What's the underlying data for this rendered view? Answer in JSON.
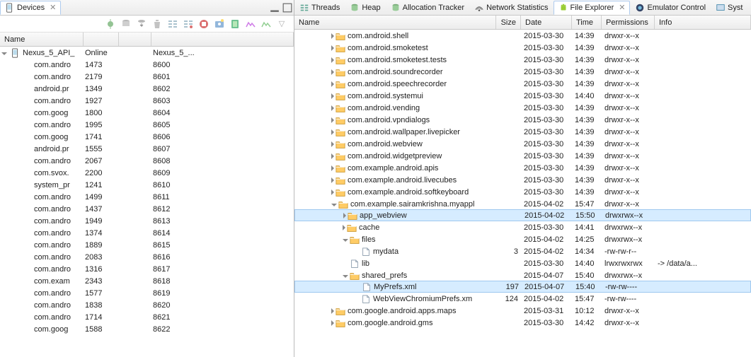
{
  "left": {
    "tab_title": "Devices",
    "header": "Name",
    "device_name": "Nexus_5_API_",
    "device_status": "Online",
    "device_col4": "Nexus_5_...",
    "processes": [
      {
        "name": "com.andro",
        "pid": "1473",
        "port": "8600"
      },
      {
        "name": "com.andro",
        "pid": "2179",
        "port": "8601"
      },
      {
        "name": "android.pr",
        "pid": "1349",
        "port": "8602"
      },
      {
        "name": "com.andro",
        "pid": "1927",
        "port": "8603"
      },
      {
        "name": "com.goog",
        "pid": "1800",
        "port": "8604"
      },
      {
        "name": "com.andro",
        "pid": "1995",
        "port": "8605"
      },
      {
        "name": "com.goog",
        "pid": "1741",
        "port": "8606"
      },
      {
        "name": "android.pr",
        "pid": "1555",
        "port": "8607"
      },
      {
        "name": "com.andro",
        "pid": "2067",
        "port": "8608"
      },
      {
        "name": "com.svox.",
        "pid": "2200",
        "port": "8609"
      },
      {
        "name": "system_pr",
        "pid": "1241",
        "port": "8610"
      },
      {
        "name": "com.andro",
        "pid": "1499",
        "port": "8611"
      },
      {
        "name": "com.andro",
        "pid": "1437",
        "port": "8612"
      },
      {
        "name": "com.andro",
        "pid": "1949",
        "port": "8613"
      },
      {
        "name": "com.andro",
        "pid": "1374",
        "port": "8614"
      },
      {
        "name": "com.andro",
        "pid": "1889",
        "port": "8615"
      },
      {
        "name": "com.andro",
        "pid": "2083",
        "port": "8616"
      },
      {
        "name": "com.andro",
        "pid": "1316",
        "port": "8617"
      },
      {
        "name": "com.exam",
        "pid": "2343",
        "port": "8618"
      },
      {
        "name": "com.andro",
        "pid": "1577",
        "port": "8619"
      },
      {
        "name": "com.andro",
        "pid": "1838",
        "port": "8620"
      },
      {
        "name": "com.andro",
        "pid": "1714",
        "port": "8621"
      },
      {
        "name": "com.goog",
        "pid": "1588",
        "port": "8622"
      }
    ]
  },
  "right": {
    "tabs": [
      {
        "label": "Threads",
        "icon": "threads"
      },
      {
        "label": "Heap",
        "icon": "heap"
      },
      {
        "label": "Allocation Tracker",
        "icon": "heap"
      },
      {
        "label": "Network Statistics",
        "icon": "net"
      },
      {
        "label": "File Explorer",
        "icon": "android"
      },
      {
        "label": "Emulator Control",
        "icon": "emu"
      },
      {
        "label": "Syst",
        "icon": "sys"
      }
    ],
    "active_tab": 4,
    "columns": {
      "c0": "Name",
      "c1": "Size",
      "c2": "Date",
      "c3": "Time",
      "c4": "Permissions",
      "c5": "Info"
    },
    "rows": [
      {
        "i": 3,
        "a": "r",
        "t": "f",
        "n": "com.android.shell",
        "d": "2015-03-30",
        "tm": "14:39",
        "p": "drwxr-x--x"
      },
      {
        "i": 3,
        "a": "r",
        "t": "f",
        "n": "com.android.smoketest",
        "d": "2015-03-30",
        "tm": "14:39",
        "p": "drwxr-x--x"
      },
      {
        "i": 3,
        "a": "r",
        "t": "f",
        "n": "com.android.smoketest.tests",
        "d": "2015-03-30",
        "tm": "14:39",
        "p": "drwxr-x--x"
      },
      {
        "i": 3,
        "a": "r",
        "t": "f",
        "n": "com.android.soundrecorder",
        "d": "2015-03-30",
        "tm": "14:39",
        "p": "drwxr-x--x"
      },
      {
        "i": 3,
        "a": "r",
        "t": "f",
        "n": "com.android.speechrecorder",
        "d": "2015-03-30",
        "tm": "14:39",
        "p": "drwxr-x--x"
      },
      {
        "i": 3,
        "a": "r",
        "t": "f",
        "n": "com.android.systemui",
        "d": "2015-03-30",
        "tm": "14:40",
        "p": "drwxr-x--x"
      },
      {
        "i": 3,
        "a": "r",
        "t": "f",
        "n": "com.android.vending",
        "d": "2015-03-30",
        "tm": "14:39",
        "p": "drwxr-x--x"
      },
      {
        "i": 3,
        "a": "r",
        "t": "f",
        "n": "com.android.vpndialogs",
        "d": "2015-03-30",
        "tm": "14:39",
        "p": "drwxr-x--x"
      },
      {
        "i": 3,
        "a": "r",
        "t": "f",
        "n": "com.android.wallpaper.livepicker",
        "d": "2015-03-30",
        "tm": "14:39",
        "p": "drwxr-x--x"
      },
      {
        "i": 3,
        "a": "r",
        "t": "f",
        "n": "com.android.webview",
        "d": "2015-03-30",
        "tm": "14:39",
        "p": "drwxr-x--x"
      },
      {
        "i": 3,
        "a": "r",
        "t": "f",
        "n": "com.android.widgetpreview",
        "d": "2015-03-30",
        "tm": "14:39",
        "p": "drwxr-x--x"
      },
      {
        "i": 3,
        "a": "r",
        "t": "f",
        "n": "com.example.android.apis",
        "d": "2015-03-30",
        "tm": "14:39",
        "p": "drwxr-x--x"
      },
      {
        "i": 3,
        "a": "r",
        "t": "f",
        "n": "com.example.android.livecubes",
        "d": "2015-03-30",
        "tm": "14:39",
        "p": "drwxr-x--x"
      },
      {
        "i": 3,
        "a": "r",
        "t": "f",
        "n": "com.example.android.softkeyboard",
        "d": "2015-03-30",
        "tm": "14:39",
        "p": "drwxr-x--x"
      },
      {
        "i": 3,
        "a": "d",
        "t": "f",
        "n": "com.example.sairamkrishna.myappl",
        "d": "2015-04-02",
        "tm": "15:47",
        "p": "drwxr-x--x"
      },
      {
        "i": 4,
        "a": "r",
        "t": "f",
        "n": "app_webview",
        "d": "2015-04-02",
        "tm": "15:50",
        "p": "drwxrwx--x",
        "sel": true
      },
      {
        "i": 4,
        "a": "r",
        "t": "f",
        "n": "cache",
        "d": "2015-03-30",
        "tm": "14:41",
        "p": "drwxrwx--x"
      },
      {
        "i": 4,
        "a": "d",
        "t": "f",
        "n": "files",
        "d": "2015-04-02",
        "tm": "14:25",
        "p": "drwxrwx--x"
      },
      {
        "i": 5,
        "a": "b",
        "t": "x",
        "n": "mydata",
        "s": "3",
        "d": "2015-04-02",
        "tm": "14:34",
        "p": "-rw-rw-r--"
      },
      {
        "i": 4,
        "a": "b",
        "t": "x",
        "n": "lib",
        "d": "2015-03-30",
        "tm": "14:40",
        "p": "lrwxrwxrwx",
        "info": "-> /data/a..."
      },
      {
        "i": 4,
        "a": "d",
        "t": "f",
        "n": "shared_prefs",
        "d": "2015-04-07",
        "tm": "15:40",
        "p": "drwxrwx--x"
      },
      {
        "i": 5,
        "a": "b",
        "t": "x",
        "n": "MyPrefs.xml",
        "s": "197",
        "d": "2015-04-07",
        "tm": "15:40",
        "p": "-rw-rw----",
        "sel": true
      },
      {
        "i": 5,
        "a": "b",
        "t": "x",
        "n": "WebViewChromiumPrefs.xm",
        "s": "124",
        "d": "2015-04-02",
        "tm": "15:47",
        "p": "-rw-rw----"
      },
      {
        "i": 3,
        "a": "r",
        "t": "f",
        "n": "com.google.android.apps.maps",
        "d": "2015-03-31",
        "tm": "10:12",
        "p": "drwxr-x--x"
      },
      {
        "i": 3,
        "a": "r",
        "t": "f",
        "n": "com.google.android.gms",
        "d": "2015-03-30",
        "tm": "14:42",
        "p": "drwxr-x--x"
      }
    ]
  }
}
